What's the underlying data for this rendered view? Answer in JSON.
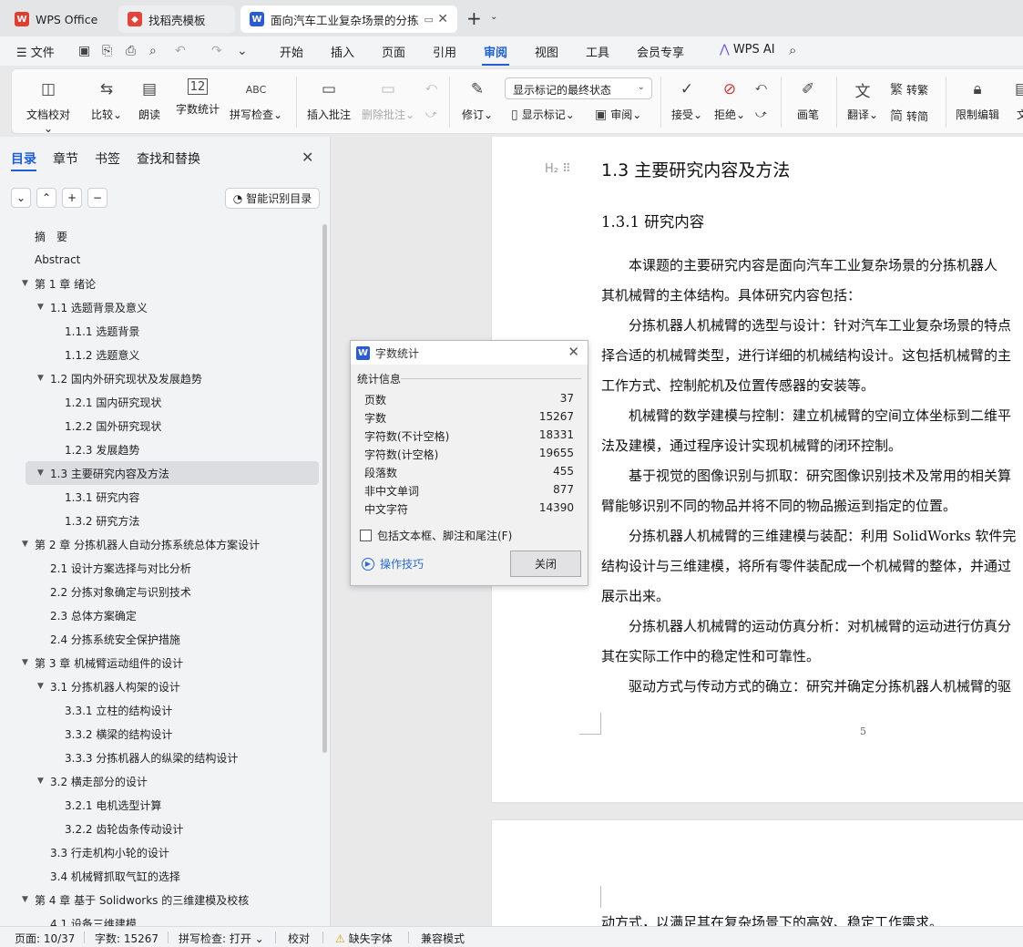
{
  "tabs": [
    {
      "label": "WPS Office",
      "icon": "wps-logo-icon"
    },
    {
      "label": "找稻壳模板",
      "icon": "docer-logo-icon"
    },
    {
      "label": "面向汽车工业复杂场景的分拣",
      "icon": "writer-doc-icon"
    }
  ],
  "menu": {
    "file": "文件",
    "items": [
      "开始",
      "插入",
      "页面",
      "引用",
      "审阅",
      "视图",
      "工具",
      "会员专享"
    ],
    "active": "审阅",
    "ai": "WPS AI"
  },
  "ribbon": {
    "doc_check": "文档校对",
    "compare": "比较",
    "read_aloud": "朗读",
    "word_count": "字数统计",
    "spell_check": "拼写检查",
    "insert_comment": "插入批注",
    "delete_comment": "删除批注",
    "revise": "修订",
    "markup_select": "显示标记的最终状态",
    "show_markup": "显示标记",
    "review": "审阅",
    "accept": "接受",
    "reject": "拒绝",
    "pen": "画笔",
    "translate": "翻译",
    "to_traditional": "转繁",
    "to_simplified": "转简",
    "restrict_edit": "限制编辑",
    "doc_more": "文"
  },
  "nav": {
    "tabs": [
      "目录",
      "章节",
      "书签",
      "查找和替换"
    ],
    "smart_toc": "智能识别目录",
    "toc": [
      {
        "text": "摘　要",
        "level": 1,
        "arrow": ""
      },
      {
        "text": "Abstract",
        "level": 1,
        "arrow": ""
      },
      {
        "text": "第 1 章  绪论",
        "level": 1,
        "arrow": "▼"
      },
      {
        "text": "1.1  选题背景及意义",
        "level": 2,
        "arrow": "▼"
      },
      {
        "text": "1.1.1 选题背景",
        "level": 3,
        "arrow": ""
      },
      {
        "text": "1.1.2 选题意义",
        "level": 3,
        "arrow": ""
      },
      {
        "text": "1.2  国内外研究现状及发展趋势",
        "level": 2,
        "arrow": "▼"
      },
      {
        "text": "1.2.1  国内研究现状",
        "level": 3,
        "arrow": ""
      },
      {
        "text": "1.2.2  国外研究现状",
        "level": 3,
        "arrow": ""
      },
      {
        "text": "1.2.3  发展趋势",
        "level": 3,
        "arrow": ""
      },
      {
        "text": "1.3  主要研究内容及方法",
        "level": 2,
        "arrow": "▼",
        "selected": true
      },
      {
        "text": "1.3.1 研究内容",
        "level": 3,
        "arrow": ""
      },
      {
        "text": "1.3.2 研究方法",
        "level": 3,
        "arrow": ""
      },
      {
        "text": "第 2 章  分拣机器人自动分拣系统总体方案设计",
        "level": 1,
        "arrow": "▼"
      },
      {
        "text": "2.1  设计方案选择与对比分析",
        "level": 2,
        "arrow": ""
      },
      {
        "text": "2.2  分拣对象确定与识别技术",
        "level": 2,
        "arrow": ""
      },
      {
        "text": "2.3  总体方案确定",
        "level": 2,
        "arrow": ""
      },
      {
        "text": "2.4  分拣系统安全保护措施",
        "level": 2,
        "arrow": ""
      },
      {
        "text": "第 3 章  机械臂运动组件的设计",
        "level": 1,
        "arrow": "▼"
      },
      {
        "text": "3.1 分拣机器人构架的设计",
        "level": 2,
        "arrow": "▼"
      },
      {
        "text": "3.3.1 立柱的结构设计",
        "level": 3,
        "arrow": ""
      },
      {
        "text": "3.3.2 横梁的结构设计",
        "level": 3,
        "arrow": ""
      },
      {
        "text": "3.3.3 分拣机器人的纵梁的结构设计",
        "level": 3,
        "arrow": ""
      },
      {
        "text": "3.2  横走部分的设计",
        "level": 2,
        "arrow": "▼"
      },
      {
        "text": "3.2.1 电机选型计算",
        "level": 3,
        "arrow": ""
      },
      {
        "text": "3.2.2 齿轮齿条传动设计",
        "level": 3,
        "arrow": ""
      },
      {
        "text": "3.3 行走机构小轮的设计",
        "level": 2,
        "arrow": ""
      },
      {
        "text": "3.4 机械臂抓取气缸的选择",
        "level": 2,
        "arrow": ""
      },
      {
        "text": "第 4 章  基于 Solidworks 的三维建模及校核",
        "level": 1,
        "arrow": "▼"
      },
      {
        "text": "4.1  设备三维建模",
        "level": 2,
        "arrow": ""
      }
    ]
  },
  "document": {
    "heading2": "1.3  主要研究内容及方法",
    "heading2_marker": "H₂",
    "heading3": "1.3.1 研究内容",
    "lines": [
      "　　本课题的主要研究内容是面向汽车工业复杂场景的分拣机器人",
      "其机械臂的主体结构。具体研究内容包括：",
      "　　分拣机器人机械臂的选型与设计：针对汽车工业复杂场景的特点",
      "择合适的机械臂类型，进行详细的机械结构设计。这包括机械臂的主",
      "工作方式、控制舵机及位置传感器的安装等。",
      "　　机械臂的数学建模与控制：建立机械臂的空间立体坐标到二维平",
      "法及建模，通过程序设计实现机械臂的闭环控制。",
      "　　基于视觉的图像识别与抓取：研究图像识别技术及常用的相关算",
      "臂能够识别不同的物品并将不同的物品搬运到指定的位置。",
      "　　分拣机器人机械臂的三维建模与装配：利用 SolidWorks 软件完",
      "结构设计与三维建模，将所有零件装配成一个机械臂的整体，并通过",
      "展示出来。",
      "　　分拣机器人机械臂的运动仿真分析：对机械臂的运动进行仿真分",
      "其在实际工作中的稳定性和可靠性。",
      "　　驱动方式与传动方式的确立：研究并确定分拣机器人机械臂的驱"
    ],
    "page_number": "5",
    "page2_line": "动方式，以满足其在复杂场景下的高效、稳定工作需求。"
  },
  "dialog": {
    "title": "字数统计",
    "group": "统计信息",
    "stats": [
      {
        "label": "页数",
        "value": "37"
      },
      {
        "label": "字数",
        "value": "15267"
      },
      {
        "label": "字符数(不计空格)",
        "value": "18331"
      },
      {
        "label": "字符数(计空格)",
        "value": "19655"
      },
      {
        "label": "段落数",
        "value": "455"
      },
      {
        "label": "非中文单词",
        "value": "877"
      },
      {
        "label": "中文字符",
        "value": "14390"
      }
    ],
    "checkbox": "包括文本框、脚注和尾注(F)",
    "tips": "操作技巧",
    "close": "关闭"
  },
  "status": {
    "page": "页面: 10/37",
    "words": "字数: 15267",
    "spell": "拼写检查: 打开",
    "proof": "校对",
    "missing_font": "缺失字体",
    "compat": "兼容模式"
  }
}
